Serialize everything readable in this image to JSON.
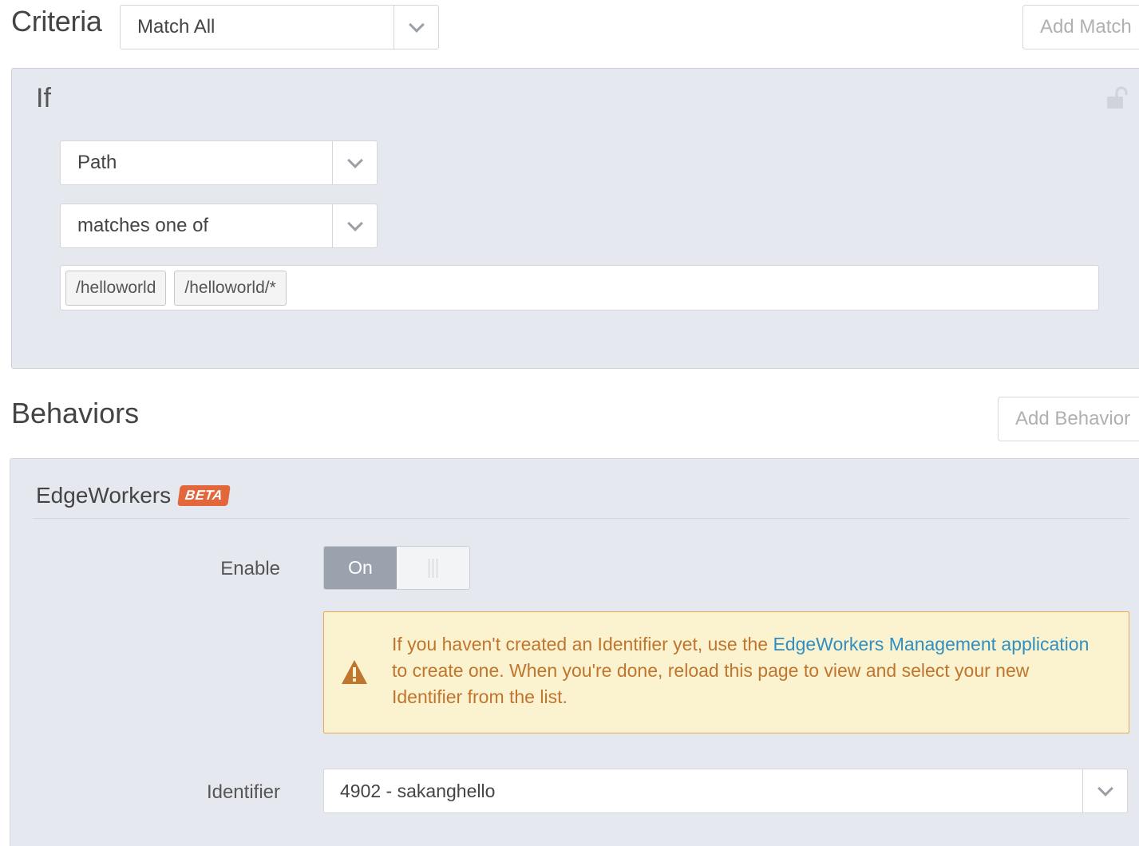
{
  "criteria": {
    "title": "Criteria",
    "match_select_value": "Match All",
    "add_match_label": "Add Match"
  },
  "if_block": {
    "label": "If",
    "condition_field": "Path",
    "operator": "matches one of",
    "values": [
      "/helloworld",
      "/helloworld/*"
    ]
  },
  "behaviors": {
    "title": "Behaviors",
    "add_behavior_label": "Add Behavior",
    "edgeworkers": {
      "title": "EdgeWorkers",
      "badge": "BETA",
      "enable_label": "Enable",
      "toggle_on_label": "On",
      "warning": {
        "text_before": "If you haven't created an Identifier yet, use the ",
        "link_text": "EdgeWorkers Management application",
        "text_after": " to create one. When you're done, reload this page to view and select your new Identifier from the list."
      },
      "identifier_label": "Identifier",
      "identifier_value": "4902 - sakanghello"
    }
  },
  "colors": {
    "panel_bg": "#e5e8ee",
    "beta_badge": "#e2673a",
    "warning_bg": "#fbf3cf",
    "warning_text": "#c0752e",
    "link": "#2f8fc2",
    "toggle_on": "#9aa3ad"
  },
  "icons": [
    "chevron-down-icon",
    "lock-icon",
    "warning-icon"
  ]
}
